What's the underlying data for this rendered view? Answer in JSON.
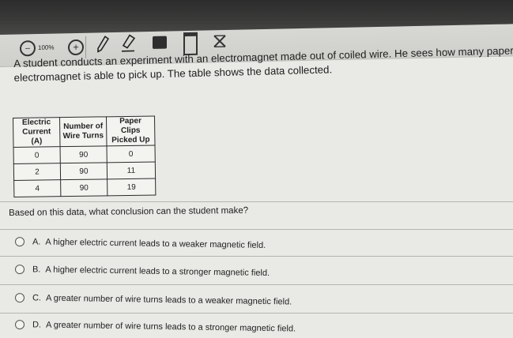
{
  "toolbar": {
    "zoom_out_symbol": "−",
    "zoom_level": "100%",
    "zoom_in_symbol": "+",
    "icons": [
      "zoom-out-icon",
      "zoom-in-icon",
      "pen-icon",
      "highlighter-icon",
      "keyboard-icon",
      "notepad-icon",
      "answer-eliminator-icon"
    ]
  },
  "question": {
    "text_line1": "A student conducts an experiment with an electromagnet made out of coiled wire. He sees how many paper c",
    "text_line2": "electromagnet is able to pick up. The table shows the data collected."
  },
  "table": {
    "headers": [
      [
        "Electric",
        "Current (A)"
      ],
      [
        "Number of",
        "Wire Turns"
      ],
      [
        "Paper Clips",
        "Picked Up"
      ]
    ],
    "rows": [
      [
        "0",
        "90",
        "0"
      ],
      [
        "2",
        "90",
        "11"
      ],
      [
        "4",
        "90",
        "19"
      ]
    ]
  },
  "prompt": "Based on this data, what conclusion can the student make?",
  "choices": [
    {
      "letter": "A.",
      "text": "A higher electric current leads to a weaker magnetic field."
    },
    {
      "letter": "B.",
      "text": "A higher electric current leads to a stronger magnetic field."
    },
    {
      "letter": "C.",
      "text": "A greater number of wire turns leads to a weaker magnetic field."
    },
    {
      "letter": "D.",
      "text": "A greater number of wire turns leads to a stronger magnetic field."
    }
  ]
}
